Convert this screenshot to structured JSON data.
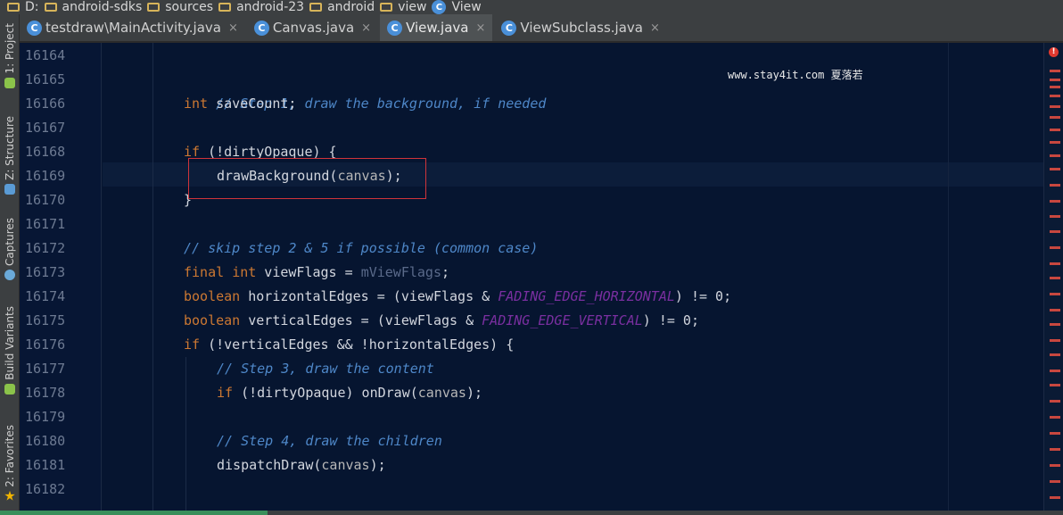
{
  "breadcrumb": {
    "drive": "D:",
    "items": [
      "android-sdks",
      "sources",
      "android-23",
      "android",
      "view",
      "View"
    ]
  },
  "tabs": [
    {
      "label": "testdraw\\MainActivity.java",
      "icon_letter": "C",
      "close": "×"
    },
    {
      "label": "Canvas.java",
      "icon_letter": "C",
      "close": "×"
    },
    {
      "label": "View.java",
      "icon_letter": "C",
      "close": "×",
      "active": true
    },
    {
      "label": "ViewSubclass.java",
      "icon_letter": "C",
      "close": "×"
    }
  ],
  "left_tools": [
    {
      "label": "1: Project",
      "icon": "android-icon"
    },
    {
      "label": "Z: Structure",
      "icon": "structure-icon"
    },
    {
      "label": "Captures",
      "icon": "captures-icon"
    },
    {
      "label": "Build Variants",
      "icon": "android-icon"
    },
    {
      "label": "2: Favorites",
      "icon": "star-icon"
    }
  ],
  "line_numbers": [
    "16164",
    "16165",
    "16166",
    "16167",
    "16168",
    "16169",
    "16170",
    "16171",
    "16172",
    "16173",
    "16174",
    "16175",
    "16176",
    "16177",
    "16178",
    "16179",
    "16180",
    "16181",
    "16182"
  ],
  "code": {
    "l16165": "// Step 1, draw the background, if needed",
    "l16166_kw": "int",
    "l16166_rest": " saveCount;",
    "l16168_kw": "if",
    "l16168_rest": " (!dirtyOpaque) {",
    "l16169_fn": "drawBackground(",
    "l16169_arg": "canvas",
    "l16169_end": ");",
    "l16170": "}",
    "l16172": "// skip step 2 & 5 if possible (common case)",
    "l16173_kw1": "final",
    "l16173_kw2": "int",
    "l16173_mid": " viewFlags = ",
    "l16173_fld": "mViewFlags",
    "l16173_end": ";",
    "l16174_kw": "boolean",
    "l16174_mid": " horizontalEdges = (viewFlags & ",
    "l16174_const": "FADING_EDGE_HORIZONTAL",
    "l16174_end": ") != 0;",
    "l16175_kw": "boolean",
    "l16175_mid": " verticalEdges = (viewFlags & ",
    "l16175_const": "FADING_EDGE_VERTICAL",
    "l16175_end": ") != 0;",
    "l16176_kw": "if",
    "l16176_rest": " (!verticalEdges && !horizontalEdges) {",
    "l16177": "// Step 3, draw the content",
    "l16178_kw": "if",
    "l16178_mid": " (!dirtyOpaque) onDraw(",
    "l16178_arg": "canvas",
    "l16178_end": ");",
    "l16180": "// Step 4, draw the children",
    "l16181_fn": "dispatchDraw(",
    "l16181_arg": "canvas",
    "l16181_end": ");"
  },
  "watermark": "www.stay4it.com 夏落若",
  "error_badge": "!",
  "colors": {
    "editor_bg": "#061530",
    "keyword": "#cc7832",
    "comment": "#4e87c8",
    "highlight_box": "#d0343a"
  }
}
